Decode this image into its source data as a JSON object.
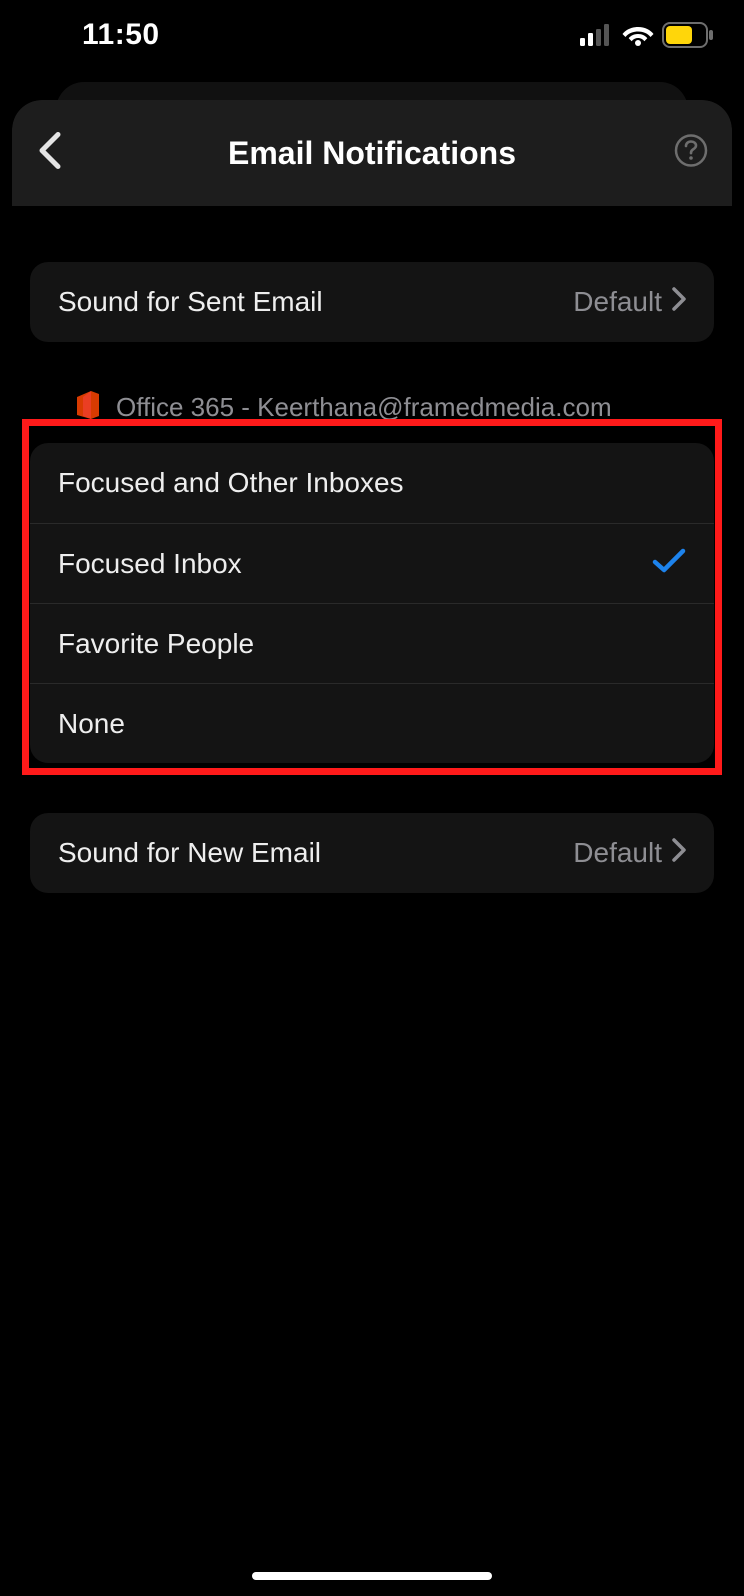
{
  "status": {
    "time": "11:50"
  },
  "header": {
    "title": "Email Notifications"
  },
  "rows": {
    "sound_sent": {
      "label": "Sound for Sent Email",
      "value": "Default"
    },
    "sound_new": {
      "label": "Sound for New Email",
      "value": "Default"
    }
  },
  "account": {
    "label": "Office 365 - Keerthana@framedmedia.com"
  },
  "options": {
    "focused_other": "Focused and Other Inboxes",
    "focused": "Focused Inbox",
    "favorite": "Favorite People",
    "none": "None",
    "selected": "focused"
  }
}
